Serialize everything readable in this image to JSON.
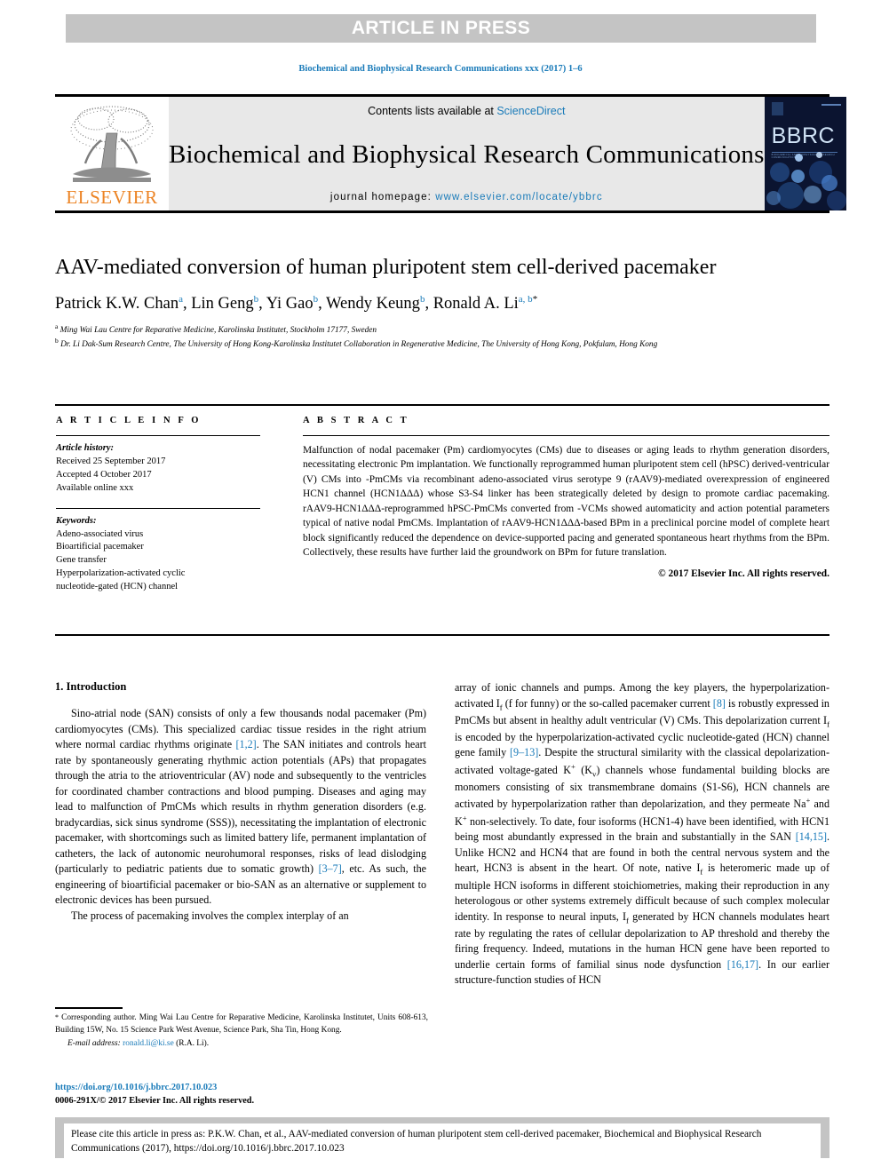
{
  "banner": {
    "text": "ARTICLE IN PRESS"
  },
  "journal_ref": "Biochemical and Biophysical Research Communications xxx (2017) 1–6",
  "masthead": {
    "publisher_name": "ELSEVIER",
    "contents_prefix": "Contents lists available at ",
    "contents_link": "ScienceDirect",
    "journal_title": "Biochemical and Biophysical Research Communications",
    "homepage_prefix": "journal homepage: ",
    "homepage_url": "www.elsevier.com/locate/ybbrc",
    "cover_title": "BBRC",
    "cover_subtitle": "BIOCHEMICAL AND BIOPHYSICAL RESEARCH COMMUNICATIONS"
  },
  "article": {
    "title": "AAV-mediated conversion of human pluripotent stem cell-derived pacemaker",
    "authors": [
      {
        "name": "Patrick K.W. Chan",
        "sup": "a",
        "sep": ", "
      },
      {
        "name": "Lin Geng",
        "sup": "b",
        "sep": ", "
      },
      {
        "name": "Yi Gao",
        "sup": "b",
        "sep": ", "
      },
      {
        "name": "Wendy Keung",
        "sup": "b",
        "sep": ", "
      },
      {
        "name": "Ronald A. Li",
        "sup": "a, b",
        "sep": "",
        "star": "*"
      }
    ],
    "affiliations": [
      {
        "marker": "a",
        "text": "Ming Wai Lau Centre for Reparative Medicine, Karolinska Institutet, Stockholm 17177, Sweden"
      },
      {
        "marker": "b",
        "text": "Dr. Li Dak-Sum Research Centre, The University of Hong Kong-Karolinska Institutet Collaboration in Regenerative Medicine, The University of Hong Kong, Pokfulam, Hong Kong"
      }
    ]
  },
  "article_info": {
    "heading": "A R T I C L E  I N F O",
    "history_label": "Article history:",
    "history": [
      "Received 25 September 2017",
      "Accepted 4 October 2017",
      "Available online xxx"
    ],
    "keywords_label": "Keywords:",
    "keywords": [
      "Adeno-associated virus",
      "Bioartificial pacemaker",
      "Gene transfer",
      "Hyperpolarization-activated cyclic",
      "nucleotide-gated (HCN) channel"
    ]
  },
  "abstract": {
    "heading": "A B S T R A C T",
    "text": "Malfunction of nodal pacemaker (Pm) cardiomyocytes (CMs) due to diseases or aging leads to rhythm generation disorders, necessitating electronic Pm implantation. We functionally reprogrammed human pluripotent stem cell (hPSC) derived-ventricular (V) CMs into -PmCMs via recombinant adeno-associated virus serotype 9 (rAAV9)-mediated overexpression of engineered HCN1 channel (HCN1ΔΔΔ) whose S3-S4 linker has been strategically deleted by design to promote cardiac pacemaking. rAAV9-HCN1ΔΔΔ-reprogrammed hPSC-PmCMs converted from -VCMs showed automaticity and action potential parameters typical of native nodal PmCMs. Implantation of rAAV9-HCN1ΔΔΔ-based BPm in a preclinical porcine model of complete heart block significantly reduced the dependence on device-supported pacing and generated spontaneous heart rhythms from the BPm. Collectively, these results have further laid the groundwork on BPm for future translation.",
    "copyright": "© 2017 Elsevier Inc. All rights reserved."
  },
  "body": {
    "section_heading": "1. Introduction",
    "left_paragraphs": [
      "Sino-atrial node (SAN) consists of only a few thousands nodal pacemaker (Pm) cardiomyocytes (CMs). This specialized cardiac tissue resides in the right atrium where normal cardiac rhythms originate [1,2]. The SAN initiates and controls heart rate by spontaneously generating rhythmic action potentials (APs) that propagates through the atria to the atrioventricular (AV) node and subsequently to the ventricles for coordinated chamber contractions and blood pumping. Diseases and aging may lead to malfunction of PmCMs which results in rhythm generation disorders (e.g. bradycardias, sick sinus syndrome (SSS)), necessitating the implantation of electronic pacemaker, with shortcomings such as limited battery life, permanent implantation of catheters, the lack of autonomic neurohumoral responses, risks of lead dislodging (particularly to pediatric patients due to somatic growth) [3–7], etc. As such, the engineering of bioartificial pacemaker or bio-SAN as an alternative or supplement to electronic devices has been pursued.",
      "The process of pacemaking involves the complex interplay of an"
    ],
    "right_paragraph": "array of ionic channels and pumps. Among the key players, the hyperpolarization-activated If (f for funny) or the so-called pacemaker current [8] is robustly expressed in PmCMs but absent in healthy adult ventricular (V) CMs. This depolarization current If is encoded by the hyperpolarization-activated cyclic nucleotide-gated (HCN) channel gene family [9–13]. Despite the structural similarity with the classical depolarization-activated voltage-gated K+ (Kv) channels whose fundamental building blocks are monomers consisting of six transmembrane domains (S1-S6), HCN channels are activated by hyperpolarization rather than depolarization, and they permeate Na+ and K+ non-selectively. To date, four isoforms (HCN1-4) have been identified, with HCN1 being most abundantly expressed in the brain and substantially in the SAN [14,15]. Unlike HCN2 and HCN4 that are found in both the central nervous system and the heart, HCN3 is absent in the heart. Of note, native If is heteromeric made up of multiple HCN isoforms in different stoichiometries, making their reproduction in any heterologous or other systems extremely difficult because of such complex molecular identity. In response to neural inputs, If generated by HCN channels modulates heart rate by regulating the rates of cellular depolarization to AP threshold and thereby the firing frequency. Indeed, mutations in the human HCN gene have been reported to underlie certain forms of familial sinus node dysfunction [16,17]. In our earlier structure-function studies of HCN"
  },
  "footnote": {
    "star": "*",
    "text": " Corresponding author. Ming Wai Lau Centre for Reparative Medicine, Karolinska Institutet, Units 608-613, Building 15W, No. 15 Science Park West Avenue, Science Park, Sha Tin, Hong Kong.",
    "email_label": "E-mail address:",
    "email": "ronald.li@ki.se",
    "email_suffix": " (R.A. Li)."
  },
  "doi_block": {
    "doi": "https://doi.org/10.1016/j.bbrc.2017.10.023",
    "issn": "0006-291X/© 2017 Elsevier Inc. All rights reserved."
  },
  "citation_box": {
    "text": "Please cite this article in press as: P.K.W. Chan, et al., AAV-mediated conversion of human pluripotent stem cell-derived pacemaker, Biochemical and Biophysical Research Communications (2017), https://doi.org/10.1016/j.bbrc.2017.10.023"
  },
  "colors": {
    "link": "#1a7bb9",
    "banner_bg": "#c4c4c4",
    "masthead_bg": "#e8e8e8",
    "elsevier_orange": "#ec8425",
    "cover_bg": "#0b1430"
  }
}
